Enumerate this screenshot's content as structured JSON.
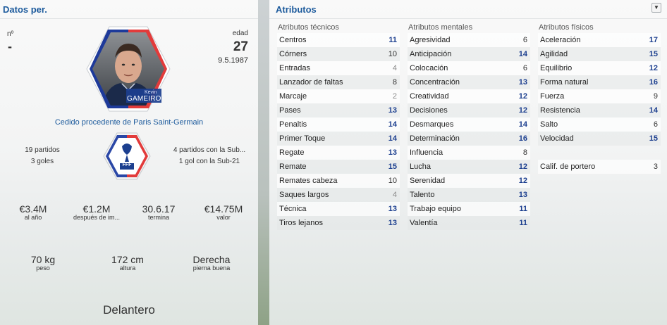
{
  "left": {
    "title": "Datos per.",
    "number_label": "nº",
    "number_value": "-",
    "age_label": "edad",
    "age_value": "27",
    "dob": "9.5.1987",
    "player_first": "Kevin",
    "player_last": "GAMEIRO",
    "loan_text": "Cedido procedente de Paris Saint-Germain",
    "club_apps": "19 partidos",
    "club_goals": "3 goles",
    "u21_apps": "4 partidos con la Sub...",
    "u21_goals": "1 gol con la Sub-21",
    "crest_text": "FFF",
    "wage_value": "€3.4M",
    "wage_label": "al año",
    "after_value": "€1.2M",
    "after_label": "después de im...",
    "expires_value": "30.6.17",
    "expires_label": "termina",
    "value_value": "€14.75M",
    "value_label": "valor",
    "weight_value": "70 kg",
    "weight_label": "peso",
    "height_value": "172 cm",
    "height_label": "altura",
    "foot_value": "Derecha",
    "foot_label": "pierna buena",
    "position": "Delantero"
  },
  "right": {
    "title": "Atributos",
    "technical": {
      "header": "Atributos técnicos",
      "items": [
        {
          "name": "Centros",
          "value": "11"
        },
        {
          "name": "Córners",
          "value": "10"
        },
        {
          "name": "Entradas",
          "value": "4"
        },
        {
          "name": "Lanzador de faltas",
          "value": "8"
        },
        {
          "name": "Marcaje",
          "value": "2"
        },
        {
          "name": "Pases",
          "value": "13"
        },
        {
          "name": "Penaltis",
          "value": "14"
        },
        {
          "name": "Primer Toque",
          "value": "14"
        },
        {
          "name": "Regate",
          "value": "13"
        },
        {
          "name": "Remate",
          "value": "15"
        },
        {
          "name": "Remates cabeza",
          "value": "10"
        },
        {
          "name": "Saques largos",
          "value": "4"
        },
        {
          "name": "Técnica",
          "value": "13"
        },
        {
          "name": "Tiros lejanos",
          "value": "13"
        }
      ]
    },
    "mental": {
      "header": "Atributos mentales",
      "items": [
        {
          "name": "Agresividad",
          "value": "6"
        },
        {
          "name": "Anticipación",
          "value": "14"
        },
        {
          "name": "Colocación",
          "value": "6"
        },
        {
          "name": "Concentración",
          "value": "13"
        },
        {
          "name": "Creatividad",
          "value": "12"
        },
        {
          "name": "Decisiones",
          "value": "12"
        },
        {
          "name": "Desmarques",
          "value": "14"
        },
        {
          "name": "Determinación",
          "value": "16"
        },
        {
          "name": "Influencia",
          "value": "8"
        },
        {
          "name": "Lucha",
          "value": "12"
        },
        {
          "name": "Serenidad",
          "value": "12"
        },
        {
          "name": "Talento",
          "value": "13"
        },
        {
          "name": "Trabajo equipo",
          "value": "11"
        },
        {
          "name": "Valentía",
          "value": "11"
        }
      ]
    },
    "physical": {
      "header": "Atributos físicos",
      "items": [
        {
          "name": "Aceleración",
          "value": "17"
        },
        {
          "name": "Agilidad",
          "value": "15"
        },
        {
          "name": "Equilibrio",
          "value": "12"
        },
        {
          "name": "Forma natural",
          "value": "16"
        },
        {
          "name": "Fuerza",
          "value": "9"
        },
        {
          "name": "Resistencia",
          "value": "14"
        },
        {
          "name": "Salto",
          "value": "6"
        },
        {
          "name": "Velocidad",
          "value": "15"
        }
      ],
      "gk_name": "Calif. de portero",
      "gk_value": "3"
    },
    "colors": {
      "high": "#1c3f8f",
      "mid": "#333333",
      "low": "#8a8a8a",
      "title": "#1c5a9c"
    }
  }
}
